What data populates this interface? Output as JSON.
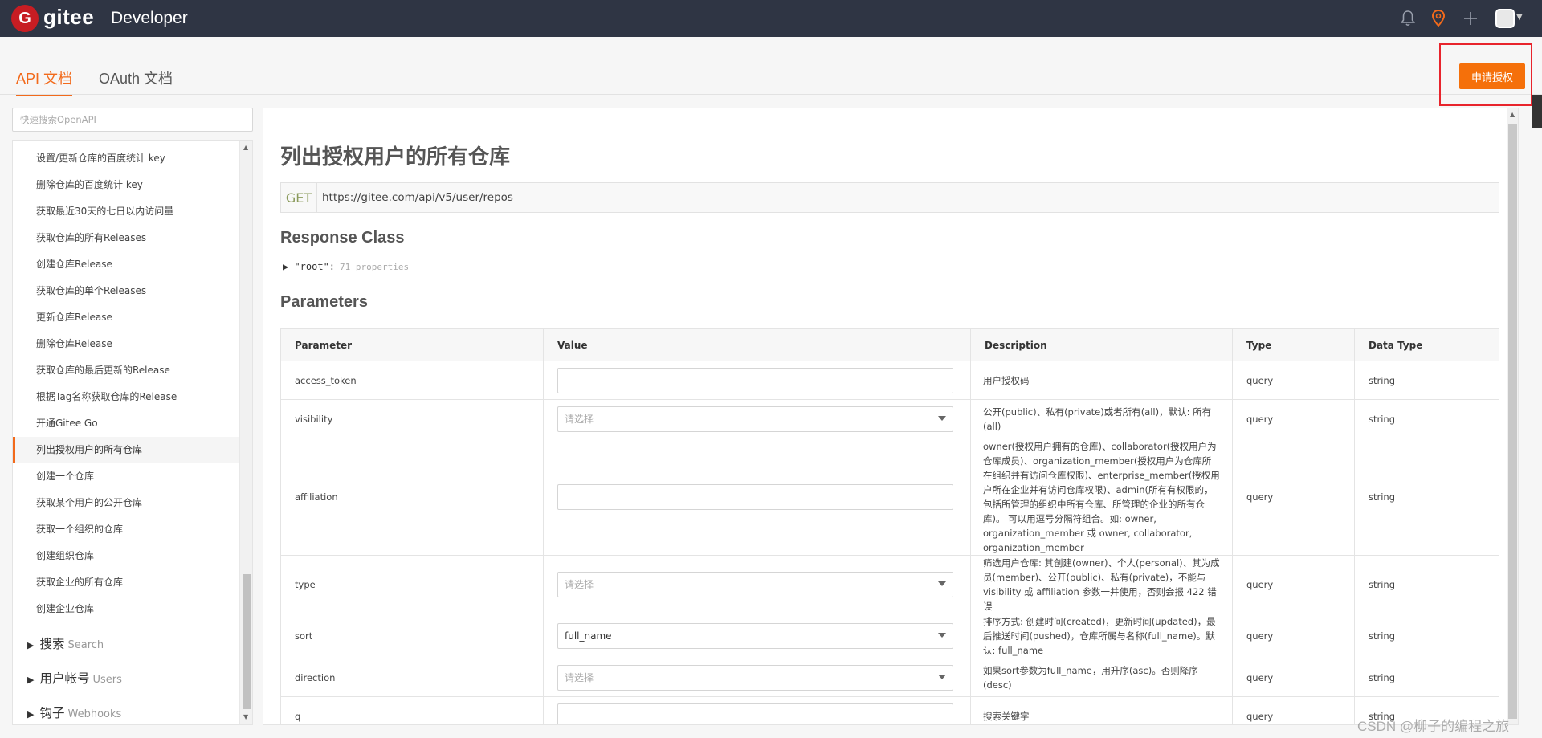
{
  "header": {
    "logo_letter": "G",
    "logo_text": "gitee",
    "product": "Developer",
    "icons": [
      "bell-icon",
      "location-pin-icon",
      "plus-icon",
      "avatar-icon"
    ]
  },
  "tabs": [
    {
      "label": "API 文档",
      "active": true
    },
    {
      "label": "OAuth 文档",
      "active": false
    }
  ],
  "apply_button": "申请授权",
  "search": {
    "placeholder": "快速搜索OpenAPI"
  },
  "sidebar": {
    "items": [
      "设置/更新仓库的百度统计 key",
      "删除仓库的百度统计 key",
      "获取最近30天的七日以内访问量",
      "获取仓库的所有Releases",
      "创建仓库Release",
      "获取仓库的单个Releases",
      "更新仓库Release",
      "删除仓库Release",
      "获取仓库的最后更新的Release",
      "根据Tag名称获取仓库的Release",
      "开通Gitee Go",
      "列出授权用户的所有仓库",
      "创建一个仓库",
      "获取某个用户的公开仓库",
      "获取一个组织的仓库",
      "创建组织仓库",
      "获取企业的所有仓库",
      "创建企业仓库"
    ],
    "active_index": 11,
    "groups": [
      {
        "label": "搜索",
        "en": "Search"
      },
      {
        "label": "用户帐号",
        "en": "Users"
      },
      {
        "label": "钩子",
        "en": "Webhooks"
      }
    ]
  },
  "main": {
    "title": "列出授权用户的所有仓库",
    "method": "GET",
    "url": "https://gitee.com/api/v5/user/repos",
    "response_class_title": "Response Class",
    "root_label": "▶ \"root\":",
    "root_props": "71 properties",
    "parameters_title": "Parameters",
    "columns": [
      "Parameter",
      "Value",
      "Description",
      "Type",
      "Data Type"
    ],
    "rows": [
      {
        "param": "access_token",
        "value": "",
        "placeholder": "",
        "kind": "input",
        "desc": "用户授权码",
        "type": "query",
        "dtype": "string"
      },
      {
        "param": "visibility",
        "value": "",
        "placeholder": "请选择",
        "kind": "select",
        "desc": "公开(public)、私有(private)或者所有(all)，默认: 所有(all)",
        "type": "query",
        "dtype": "string"
      },
      {
        "param": "affiliation",
        "value": "",
        "placeholder": "",
        "kind": "input",
        "desc": "owner(授权用户拥有的仓库)、collaborator(授权用户为仓库成员)、organization_member(授权用户为仓库所在组织并有访问仓库权限)、enterprise_member(授权用户所在企业并有访问仓库权限)、admin(所有有权限的，包括所管理的组织中所有仓库、所管理的企业的所有仓库)。 可以用逗号分隔符组合。如: owner, organization_member 或 owner, collaborator, organization_member",
        "type": "query",
        "dtype": "string"
      },
      {
        "param": "type",
        "value": "",
        "placeholder": "请选择",
        "kind": "select",
        "desc": "筛选用户仓库: 其创建(owner)、个人(personal)、其为成员(member)、公开(public)、私有(private)，不能与 visibility 或 affiliation 参数一并使用，否则会报 422 错误",
        "type": "query",
        "dtype": "string"
      },
      {
        "param": "sort",
        "value": "full_name",
        "placeholder": "",
        "kind": "select",
        "desc": "排序方式: 创建时间(created)，更新时间(updated)，最后推送时间(pushed)，仓库所属与名称(full_name)。默认: full_name",
        "type": "query",
        "dtype": "string"
      },
      {
        "param": "direction",
        "value": "",
        "placeholder": "请选择",
        "kind": "select",
        "desc": "如果sort参数为full_name，用升序(asc)。否则降序(desc)",
        "type": "query",
        "dtype": "string"
      },
      {
        "param": "q",
        "value": "",
        "placeholder": "",
        "kind": "input",
        "desc": "搜索关键字",
        "type": "query",
        "dtype": "string"
      }
    ]
  },
  "watermark": "CSDN @柳子的编程之旅",
  "colors": {
    "accent": "#f26a1b",
    "topbar": "#2f3544",
    "button": "#f5700a",
    "outline": "#e8242c"
  }
}
